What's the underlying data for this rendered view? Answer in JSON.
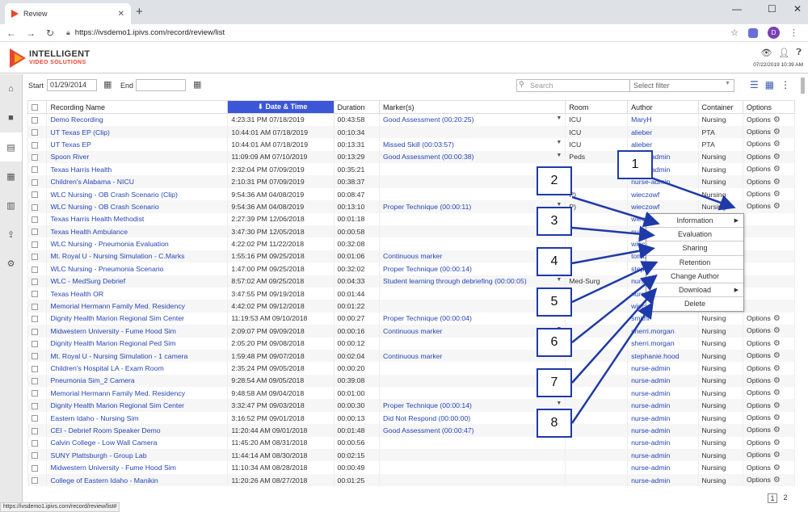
{
  "browser": {
    "tab_title": "Review",
    "url": "https://ivsdemo1.ipivs.com/record/review/list",
    "profile_initial": "D",
    "status_url": "https://ivsdemo1.ipivs.com/record/review/list#"
  },
  "app": {
    "logo_name": "INTELLIGENT",
    "logo_sub": "VIDEO SOLUTIONS",
    "datetime": "07/22/2019 10:39 AM"
  },
  "filters": {
    "start_label": "Start",
    "start_value": "01/29/2014",
    "end_label": "End",
    "end_value": "",
    "search_placeholder": "Search",
    "select_filter": "Select filter"
  },
  "table": {
    "headers": {
      "name": "Recording Name",
      "datetime": "Date & Time",
      "duration": "Duration",
      "markers": "Marker(s)",
      "room": "Room",
      "author": "Author",
      "container": "Container",
      "options": "Options"
    },
    "rows": [
      {
        "name": "Demo Recording",
        "dt": "4:23:31 PM 07/18/2019",
        "dur": "00:43:58",
        "marker": "Good Assessment (00:20:25)",
        "mdd": true,
        "room": "ICU",
        "author": "MaryH",
        "container": "Nursing",
        "options": "Options"
      },
      {
        "name": "UT Texas EP (Clip)",
        "dt": "10:44:01 AM 07/18/2019",
        "dur": "00:10:34",
        "marker": "",
        "mdd": false,
        "room": "ICU",
        "author": "alieber",
        "container": "PTA",
        "options": "Options"
      },
      {
        "name": "UT Texas EP",
        "dt": "10:44:01 AM 07/18/2019",
        "dur": "00:13:31",
        "marker": "Missed Skill (00:03:57)",
        "mdd": true,
        "room": "ICU",
        "author": "alieber",
        "container": "PTA",
        "options": "Options"
      },
      {
        "name": "Spoon River",
        "dt": "11:09:09 AM 07/10/2019",
        "dur": "00:13:29",
        "marker": "Good Assessment (00:00:38)",
        "mdd": true,
        "room": "Peds",
        "author": "nurse-admin",
        "container": "Nursing",
        "options": "Options"
      },
      {
        "name": "Texas Harris Health",
        "dt": "2:32:04 PM 07/09/2019",
        "dur": "00:35:21",
        "marker": "",
        "mdd": false,
        "room": "",
        "author": "nurse-admin",
        "container": "Nursing",
        "options": "Options"
      },
      {
        "name": "Children's Alabama - NICU",
        "dt": "2:10:31 PM 07/09/2019",
        "dur": "00:38:37",
        "marker": "",
        "mdd": false,
        "room": "",
        "author": "nurse-admin",
        "container": "Nursing",
        "options": "Options"
      },
      {
        "name": "WLC Nursing - OB Crash Scenario (Clip)",
        "dt": "9:54:36 AM 04/08/2019",
        "dur": "00:08:47",
        "marker": "",
        "mdd": false,
        "room": "P)",
        "author": "wieczowf",
        "container": "Nursing",
        "options": "Options"
      },
      {
        "name": "WLC Nursing - OB Crash Scenario",
        "dt": "9:54:36 AM 04/08/2019",
        "dur": "00:13:10",
        "marker": "Proper Technique (00:00:11)",
        "mdd": true,
        "room": "P)",
        "author": "wieczowf",
        "container": "Nursing",
        "options": "Options"
      },
      {
        "name": "Texas Harris Health Methodist",
        "dt": "2:27:39 PM 12/06/2018",
        "dur": "00:01:18",
        "marker": "",
        "mdd": false,
        "room": "",
        "author": "wieczowf",
        "container": "",
        "options": ""
      },
      {
        "name": "Texas Health Ambulance",
        "dt": "3:47:30 PM 12/05/2018",
        "dur": "00:00:58",
        "marker": "",
        "mdd": false,
        "room": "",
        "author": "nurse-admin",
        "container": "",
        "options": ""
      },
      {
        "name": "WLC Nursing - Pneumonia Evaluation",
        "dt": "4:22:02 PM 11/22/2018",
        "dur": "00:32:08",
        "marker": "",
        "mdd": false,
        "room": "",
        "author": "wieczowf",
        "container": "",
        "options": ""
      },
      {
        "name": "Mt. Royal U - Nursing Simulation - C.Marks",
        "dt": "1:55:16 PM 09/25/2018",
        "dur": "00:01:06",
        "marker": "Continuous marker",
        "mdd": false,
        "room": "",
        "author": "tomorgan",
        "container": "",
        "options": ""
      },
      {
        "name": "WLC Nursing - Pneumonia Scenario",
        "dt": "1:47:00 PM 09/25/2018",
        "dur": "00:32:02",
        "marker": "Proper Technique (00:00:14)",
        "mdd": true,
        "room": "",
        "author": "stephanie.hood",
        "container": "",
        "options": ""
      },
      {
        "name": "WLC - MedSurg Debrief",
        "dt": "8:57:02 AM 09/25/2018",
        "dur": "00:04:33",
        "marker": "Student learning through debriefing (00:00:05)",
        "mdd": true,
        "room": "Med-Surg",
        "author": "nurse-admin",
        "container": "",
        "options": ""
      },
      {
        "name": "Texas Health OR",
        "dt": "3:47:55 PM 09/19/2018",
        "dur": "00:01:44",
        "marker": "",
        "mdd": false,
        "room": "",
        "author": "nurse-admin",
        "container": "",
        "options": ""
      },
      {
        "name": "Memorial Hermann Family Med. Residency",
        "dt": "4:42:02 PM 09/12/2018",
        "dur": "00:01:22",
        "marker": "",
        "mdd": false,
        "room": "",
        "author": "wieczowf",
        "container": "",
        "options": ""
      },
      {
        "name": "Dignity Health Marion Regional Sim Center",
        "dt": "11:19:53 AM 09/10/2018",
        "dur": "00:00:27",
        "marker": "Proper Technique (00:00:04)",
        "mdd": false,
        "room": "",
        "author": "smithl",
        "container": "Nursing",
        "options": "Options"
      },
      {
        "name": "Midwestern University - Fume Hood Sim",
        "dt": "2:09:07 PM 09/09/2018",
        "dur": "00:00:16",
        "marker": "Continuous marker",
        "mdd": true,
        "room": "",
        "author": "sherri.morgan",
        "container": "Nursing",
        "options": "Options"
      },
      {
        "name": "Dignity Health Marion Regional Ped Sim",
        "dt": "2:05:20 PM 09/08/2018",
        "dur": "00:00:12",
        "marker": "",
        "mdd": false,
        "room": "",
        "author": "sherri.morgan",
        "container": "Nursing",
        "options": "Options"
      },
      {
        "name": "Mt. Royal U - Nursing Simulation - 1 camera",
        "dt": "1:59:48 PM 09/07/2018",
        "dur": "00:02:04",
        "marker": "Continuous marker",
        "mdd": false,
        "room": "",
        "author": "stephanie.hood",
        "container": "Nursing",
        "options": "Options"
      },
      {
        "name": "Children's Hospital LA - Exam Room",
        "dt": "2:35:24 PM 09/05/2018",
        "dur": "00:00:20",
        "marker": "",
        "mdd": false,
        "room": "",
        "author": "nurse-admin",
        "container": "Nursing",
        "options": "Options"
      },
      {
        "name": "Pneumonia Sim_2 Camera",
        "dt": "9:28:54 AM 09/05/2018",
        "dur": "00:39:08",
        "marker": "",
        "mdd": false,
        "room": "",
        "author": "nurse-admin",
        "container": "Nursing",
        "options": "Options"
      },
      {
        "name": "Memorial Hermann Family Med. Residency",
        "dt": "9:48:58 AM 09/04/2018",
        "dur": "00:01:00",
        "marker": "",
        "mdd": false,
        "room": "",
        "author": "nurse-admin",
        "container": "Nursing",
        "options": "Options"
      },
      {
        "name": "Dignity Health Marion Regional Sim Center",
        "dt": "3:32:47 PM 09/03/2018",
        "dur": "00:00:30",
        "marker": "Proper Technique (00:00:14)",
        "mdd": true,
        "room": "",
        "author": "nurse-admin",
        "container": "Nursing",
        "options": "Options"
      },
      {
        "name": "Eastern Idaho - Nursing Sim",
        "dt": "3:16:52 PM 09/01/2018",
        "dur": "00:00:13",
        "marker": "Did Not Respond (00:00:00)",
        "mdd": true,
        "room": "",
        "author": "nurse-admin",
        "container": "Nursing",
        "options": "Options"
      },
      {
        "name": "CEI - Debrief Room Speaker Demo",
        "dt": "11:20:44 AM 09/01/2018",
        "dur": "00:01:48",
        "marker": "Good Assessment (00:00:47)",
        "mdd": false,
        "room": "",
        "author": "nurse-admin",
        "container": "Nursing",
        "options": "Options"
      },
      {
        "name": "Calvin College - Low Wall Camera",
        "dt": "11:45:20 AM 08/31/2018",
        "dur": "00:00:56",
        "marker": "",
        "mdd": false,
        "room": "",
        "author": "nurse-admin",
        "container": "Nursing",
        "options": "Options"
      },
      {
        "name": "SUNY Plattsburgh - Group Lab",
        "dt": "11:44:14 AM 08/30/2018",
        "dur": "00:02:15",
        "marker": "",
        "mdd": false,
        "room": "",
        "author": "nurse-admin",
        "container": "Nursing",
        "options": "Options"
      },
      {
        "name": "Midwestern University - Fume Hood Sim",
        "dt": "11:10:34 AM 08/28/2018",
        "dur": "00:00:49",
        "marker": "",
        "mdd": false,
        "room": "",
        "author": "nurse-admin",
        "container": "Nursing",
        "options": "Options"
      },
      {
        "name": "College of Eastern Idaho - Manikin",
        "dt": "11:20:26 AM 08/27/2018",
        "dur": "00:01:25",
        "marker": "",
        "mdd": false,
        "room": "",
        "author": "nurse-admin",
        "container": "Nursing",
        "options": "Options"
      }
    ]
  },
  "context_menu": [
    {
      "label": "Information",
      "submenu": true
    },
    {
      "label": "Evaluation",
      "submenu": false
    },
    {
      "label": "Sharing",
      "submenu": false
    },
    {
      "label": "Retention",
      "submenu": false
    },
    {
      "label": "Change Author",
      "submenu": false
    },
    {
      "label": "Download",
      "submenu": true
    },
    {
      "label": "Delete",
      "submenu": false
    }
  ],
  "callouts": [
    "1",
    "2",
    "3",
    "4",
    "5",
    "6",
    "7",
    "8"
  ],
  "pager": [
    "1",
    "2"
  ],
  "colors": {
    "accent": "#3b57d8",
    "link": "#2545b5",
    "callout": "#1e3aa8",
    "brand": "#e8452e"
  }
}
